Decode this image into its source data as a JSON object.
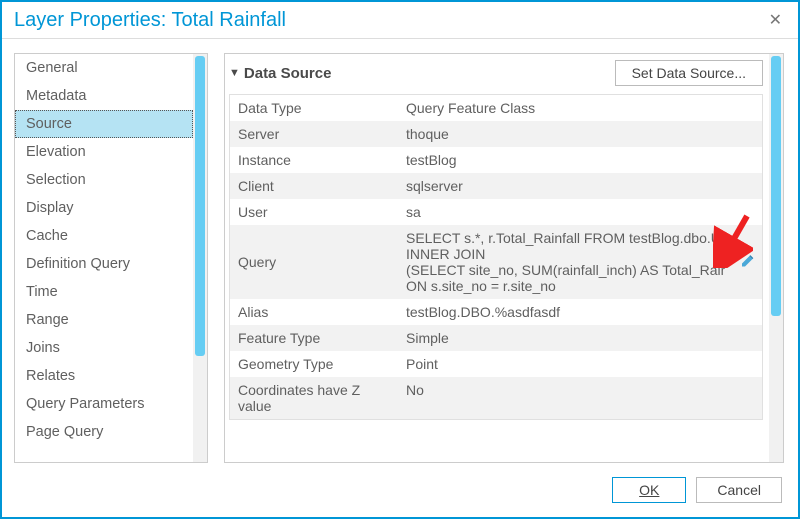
{
  "title": "Layer Properties: Total Rainfall",
  "sidebar": {
    "items": [
      {
        "label": "General"
      },
      {
        "label": "Metadata"
      },
      {
        "label": "Source",
        "selected": true
      },
      {
        "label": "Elevation"
      },
      {
        "label": "Selection"
      },
      {
        "label": "Display"
      },
      {
        "label": "Cache"
      },
      {
        "label": "Definition Query"
      },
      {
        "label": "Time"
      },
      {
        "label": "Range"
      },
      {
        "label": "Joins"
      },
      {
        "label": "Relates"
      },
      {
        "label": "Query Parameters"
      },
      {
        "label": "Page Query"
      }
    ]
  },
  "section": {
    "title": "Data Source",
    "set_btn": "Set Data Source...",
    "rows": [
      {
        "label": "Data Type",
        "value": "Query Feature Class"
      },
      {
        "label": "Server",
        "value": "thoque"
      },
      {
        "label": "Instance",
        "value": "testBlog"
      },
      {
        "label": "Client",
        "value": "sqlserver"
      },
      {
        "label": "User",
        "value": "sa"
      },
      {
        "label": "Query",
        "value": "SELECT s.*, r.Total_Rainfall FROM testBlog.dbo.U\nINNER JOIN\n(SELECT site_no, SUM(rainfall_inch) AS Total_Rair\nON s.site_no = r.site_no",
        "editable": true
      },
      {
        "label": "Alias",
        "value": "testBlog.DBO.%asdfasdf"
      },
      {
        "label": "Feature Type",
        "value": "Simple"
      },
      {
        "label": "Geometry Type",
        "value": "Point"
      },
      {
        "label": "Coordinates have Z value",
        "value": "No"
      }
    ]
  },
  "footer": {
    "ok": "OK",
    "cancel": "Cancel"
  }
}
